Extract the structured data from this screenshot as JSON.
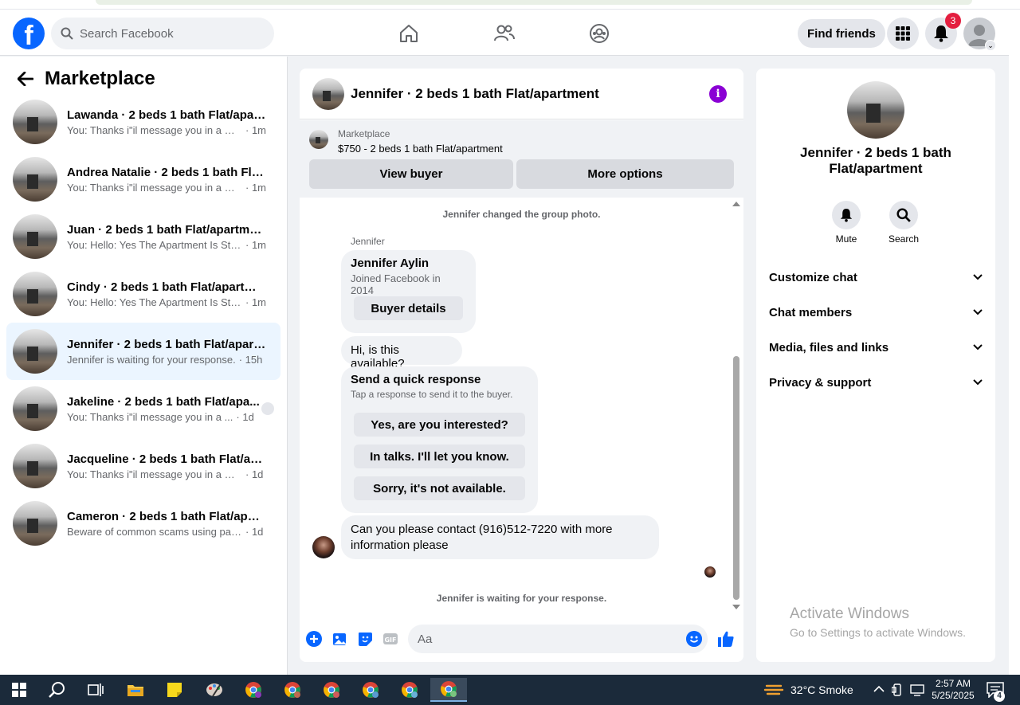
{
  "topbar": {
    "logo_letter": "f",
    "search_placeholder": "Search Facebook",
    "find_friends": "Find friends",
    "notification_count": "3"
  },
  "left": {
    "title": "Marketplace",
    "conversations": [
      {
        "title": "Lawanda · 2 beds 1 bath Flat/apart...",
        "snippet": "You: Thanks i\"il message you in a mo...",
        "time": "· 1m"
      },
      {
        "title": "Andrea Natalie · 2 beds 1 bath Flat...",
        "snippet": "You: Thanks i\"il message you in a mo...",
        "time": "· 1m"
      },
      {
        "title": "Juan · 2 beds 1 bath Flat/apartment",
        "snippet": "You: Hello: Yes The Apartment Is Still ...",
        "time": "· 1m"
      },
      {
        "title": "Cindy · 2 beds 1 bath Flat/apartment",
        "snippet": "You: Hello: Yes The Apartment Is Still ...",
        "time": "· 1m"
      },
      {
        "title": "Jennifer · 2 beds 1 bath Flat/apart...",
        "snippet": "Jennifer is waiting for your response.",
        "time": "· 15h"
      },
      {
        "title": "Jakeline · 2 beds 1 bath Flat/apa...",
        "snippet": "You: Thanks i\"il message you in a ...",
        "time": "· 1d"
      },
      {
        "title": "Jacqueline · 2 beds 1 bath Flat/apa...",
        "snippet": "You: Thanks i\"il message you in a mo...",
        "time": "· 1d"
      },
      {
        "title": "Cameron · 2 beds 1 bath Flat/apart...",
        "snippet": "Beware of common scams using pay...",
        "time": "· 1d"
      }
    ]
  },
  "chat": {
    "title": "Jennifer · 2 beds 1 bath Flat/apartment",
    "marketplace_label": "Marketplace",
    "listing": "$750 - 2 beds 1 bath Flat/apartment",
    "view_buyer": "View buyer",
    "more_options": "More options",
    "system_photo": "Jennifer changed the group photo.",
    "sender": "Jennifer",
    "buyer_name": "Jennifer Aylin",
    "buyer_joined": "Joined Facebook in 2014",
    "buyer_details": "Buyer details",
    "msg_available": "Hi, is this available?",
    "quick_title": "Send a quick response",
    "quick_sub": "Tap a response to send it to the buyer.",
    "quick_1": "Yes, are you interested?",
    "quick_2": "In talks. I'll let you know.",
    "quick_3": "Sorry, it's not available.",
    "msg_contact": "Can you please contact (916)512-7220 with more information please",
    "system_waiting": "Jennifer is waiting for your response.",
    "input_placeholder": "Aa"
  },
  "right": {
    "title": "Jennifer · 2 beds 1 bath Flat/apartment",
    "mute": "Mute",
    "search": "Search",
    "sections": [
      "Customize chat",
      "Chat members",
      "Media, files and links",
      "Privacy & support"
    ]
  },
  "watermark": {
    "line1": "Activate Windows",
    "line2": "Go to Settings to activate Windows."
  },
  "taskbar": {
    "weather": "32°C  Smoke",
    "time": "2:57 AM",
    "date": "5/25/2025",
    "notif_count": "4"
  },
  "colors": {
    "brand": "#0866ff",
    "active_row": "#ebf5ff",
    "info": "#8a00d4",
    "badge": "#e41e3f"
  }
}
